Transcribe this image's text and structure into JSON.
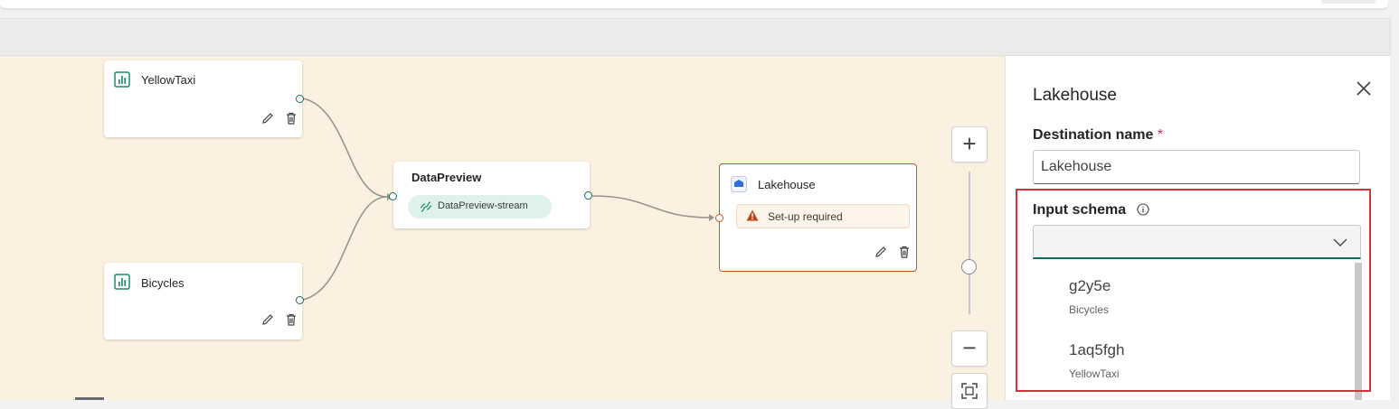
{
  "canvas": {
    "nodes": {
      "yellowtaxi": {
        "title": "YellowTaxi",
        "icon": "chart-bar-icon"
      },
      "bicycles": {
        "title": "Bicycles",
        "icon": "chart-bar-icon"
      },
      "datapreview": {
        "title": "DataPreview",
        "stream_label": "DataPreview-stream",
        "icon": "stream-icon"
      },
      "lakehouse": {
        "title": "Lakehouse",
        "warning": "Set-up required",
        "icon": "lakehouse-icon"
      }
    },
    "zoom_controls": {
      "zoom_in": "+",
      "zoom_out": "−",
      "fit": "fit-view-icon"
    }
  },
  "panel": {
    "title": "Lakehouse",
    "destination_name_label": "Destination name",
    "required_marker": "*",
    "destination_name_value": "Lakehouse",
    "input_schema_label": "Input schema",
    "input_schema_value": "",
    "options": [
      {
        "name": "g2y5e",
        "source": "Bicycles"
      },
      {
        "name": "1aq5fgh",
        "source": "YellowTaxi"
      }
    ]
  },
  "colors": {
    "canvas_bg": "#faf1e1",
    "accent_green": "#0f6c5c",
    "node_selected_border": "#c05a26",
    "highlight_red": "#d13438"
  }
}
